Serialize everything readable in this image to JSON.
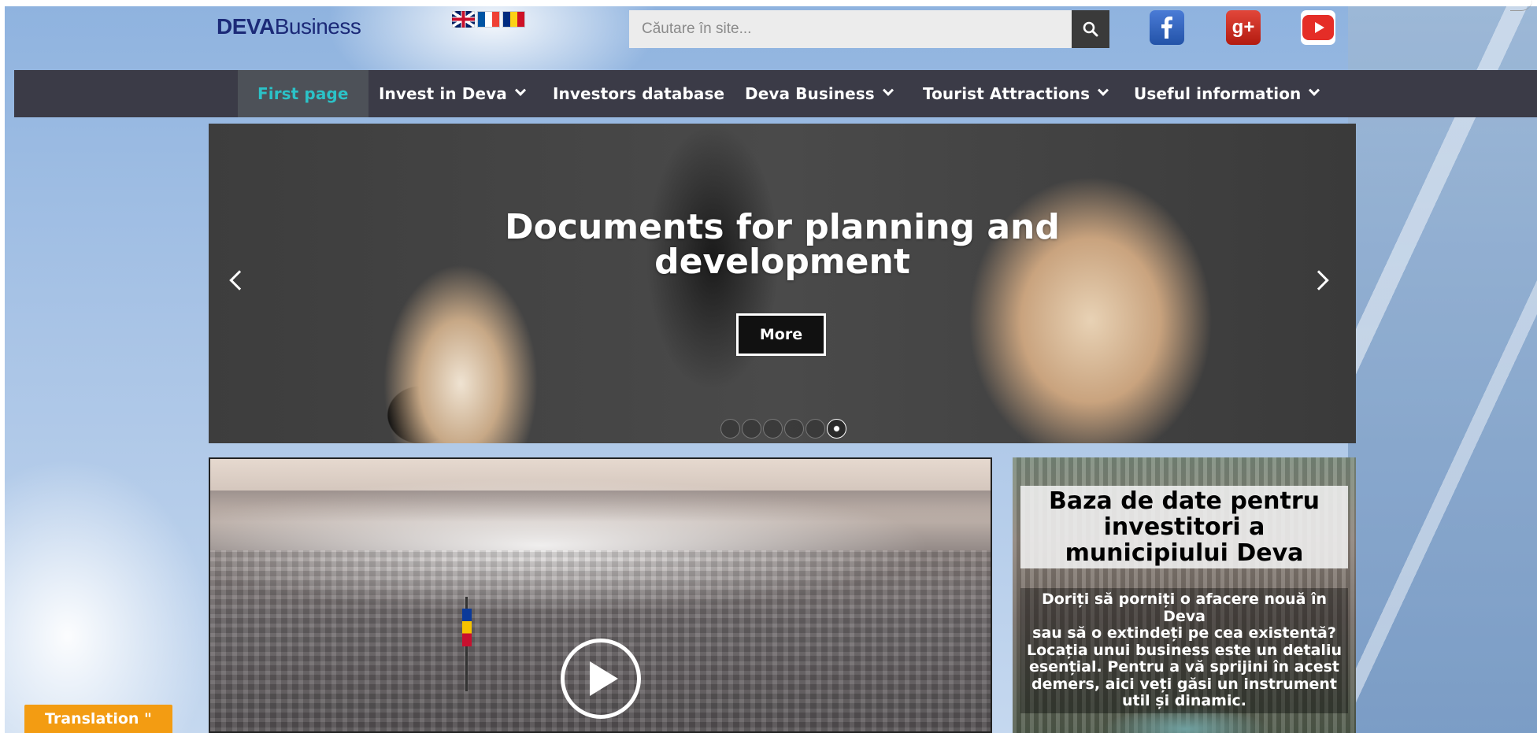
{
  "header": {
    "logo_bold": "DEVA",
    "logo_regular": "Business",
    "languages": [
      "English",
      "Français",
      "Română"
    ],
    "search_placeholder": "Căutare în site...",
    "social": [
      "facebook-icon",
      "google-plus-icon",
      "youtube-icon"
    ]
  },
  "nav": {
    "items": [
      {
        "label": "First page",
        "dropdown": false,
        "active": true
      },
      {
        "label": "Invest in Deva",
        "dropdown": true
      },
      {
        "label": "Investors database",
        "dropdown": false
      },
      {
        "label": "Deva Business",
        "dropdown": true
      },
      {
        "label": "Tourist Attractions",
        "dropdown": true
      },
      {
        "label": "Useful information",
        "dropdown": true
      }
    ]
  },
  "hero": {
    "title_line1": "Documents for planning and",
    "title_line2": "development",
    "button_label": "More",
    "slide_count": 6,
    "active_slide": 6
  },
  "card": {
    "title": "Baza de date pentru investitori a municipiului Deva",
    "text_lines": [
      "Doriți să porniți o afacere nouă în Deva",
      "sau să o extindeți pe cea existentă?",
      "Locația unui business este un detaliu",
      "esențial. Pentru a vă sprijini în acest",
      "demers, aici veți găsi un instrument",
      "util și dinamic."
    ]
  },
  "widget": {
    "translation_label": "Translation \""
  },
  "colors": {
    "nav_bg": "#3b3b47",
    "nav_active_text": "#2bc2c7",
    "logo": "#1c2a78",
    "translation_bg": "#f39c12"
  }
}
